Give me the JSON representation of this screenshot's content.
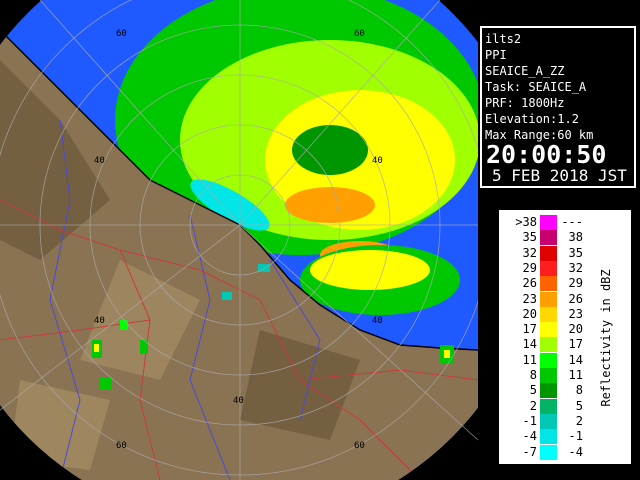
{
  "info": {
    "radar_name": "ilts2",
    "scan_type": "PPI",
    "product": "SEAICE_A_ZZ",
    "task": "Task: SEAICE_A",
    "prf": "PRF: 1800Hz",
    "elevation": "Elevation:1.2",
    "max_range": "Max Range:60 km",
    "time": "20:00:50",
    "date": "5 FEB 2018 JST"
  },
  "legend": {
    "title": "Reflectivity in dBZ",
    "rows": [
      {
        "lo": ">38",
        "hi": "---",
        "color": "#ff00ff"
      },
      {
        "lo": "35",
        "hi": "38",
        "color": "#c8006e"
      },
      {
        "lo": "32",
        "hi": "35",
        "color": "#e00000"
      },
      {
        "lo": "29",
        "hi": "32",
        "color": "#ff1e1e"
      },
      {
        "lo": "26",
        "hi": "29",
        "color": "#ff6400"
      },
      {
        "lo": "23",
        "hi": "26",
        "color": "#ffa000"
      },
      {
        "lo": "20",
        "hi": "23",
        "color": "#ffd800"
      },
      {
        "lo": "17",
        "hi": "20",
        "color": "#ffff00"
      },
      {
        "lo": "14",
        "hi": "17",
        "color": "#a0ff00"
      },
      {
        "lo": "11",
        "hi": "14",
        "color": "#00ff00"
      },
      {
        "lo": "8",
        "hi": "11",
        "color": "#00c800"
      },
      {
        "lo": "5",
        "hi": "8",
        "color": "#009600"
      },
      {
        "lo": "2",
        "hi": "5",
        "color": "#00b464"
      },
      {
        "lo": "-1",
        "hi": "2",
        "color": "#00c8b4"
      },
      {
        "lo": "-4",
        "hi": "-1",
        "color": "#00e6e6"
      },
      {
        "lo": "-7",
        "hi": "-4",
        "color": "#00ffff"
      }
    ]
  },
  "range_ring_labels": [
    "40",
    "60"
  ],
  "colors": {
    "land": "#8a7352",
    "sea": "#1e5aff",
    "outside_range": "#000000",
    "coastline": "#000000",
    "rivers": "#4b4bd2",
    "boundaries": "#c83c3c",
    "rings": "#aaaaaa"
  }
}
